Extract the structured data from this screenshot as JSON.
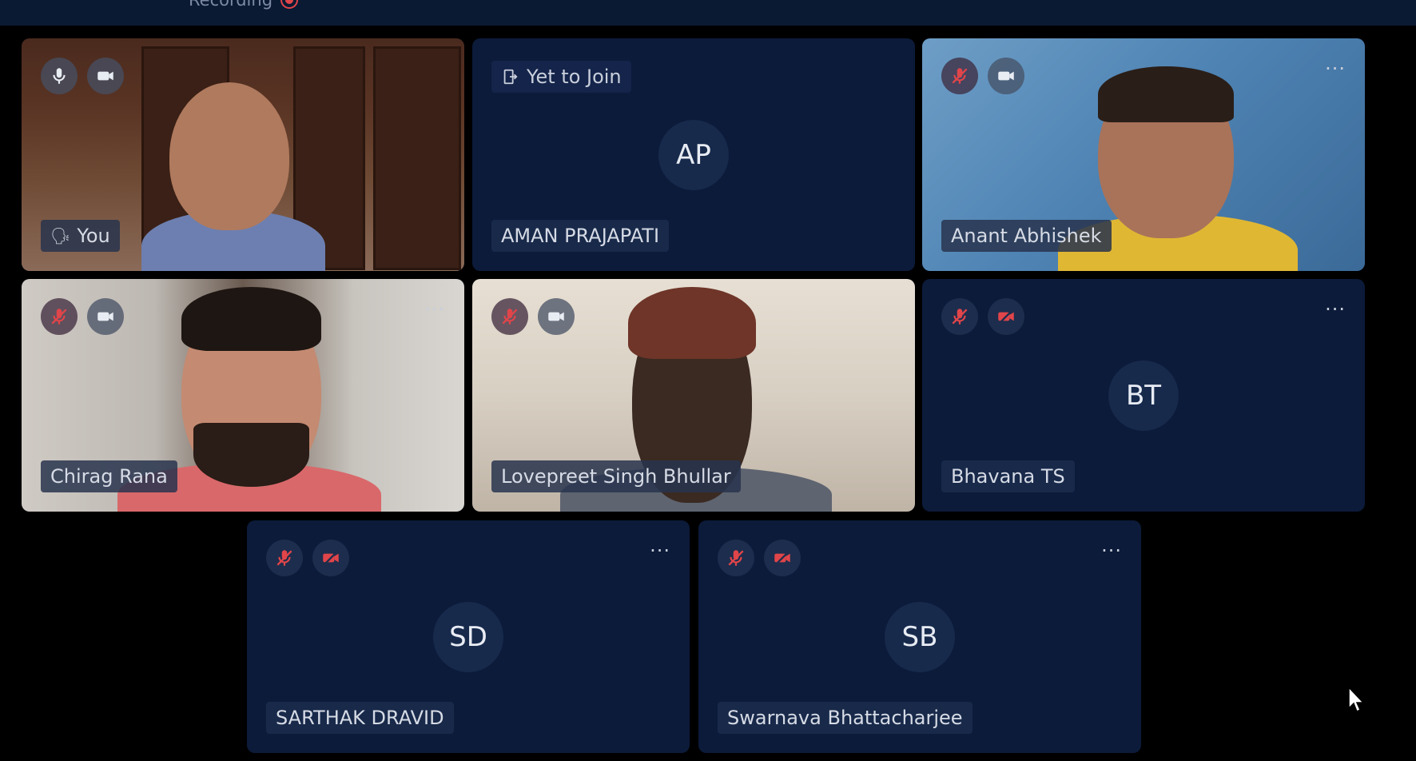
{
  "header": {
    "recording_label": "Recording"
  },
  "tiles": [
    {
      "name": "You",
      "mic": "on",
      "cam": "on",
      "speaking": true
    },
    {
      "name": "AMAN PRAJAPATI",
      "initials": "AP",
      "status": "Yet to Join"
    },
    {
      "name": "Anant Abhishek",
      "mic": "muted",
      "cam": "on"
    },
    {
      "name": "Chirag Rana",
      "mic": "muted",
      "cam": "on"
    },
    {
      "name": "Lovepreet Singh Bhullar",
      "mic": "muted",
      "cam": "on"
    },
    {
      "name": "Bhavana TS",
      "initials": "BT",
      "mic": "muted",
      "cam": "off"
    },
    {
      "name": "SARTHAK DRAVID",
      "initials": "SD",
      "mic": "muted",
      "cam": "off"
    },
    {
      "name": "Swarnava Bhattacharjee",
      "initials": "SB",
      "mic": "muted",
      "cam": "off"
    }
  ],
  "more_label": "···",
  "colors": {
    "tile_bg": "#0c1b3a",
    "muted_red": "#e0454a",
    "page_bg": "#000000"
  },
  "icons": [
    "mic-icon",
    "mic-off-icon",
    "camera-icon",
    "camera-off-icon",
    "more-options-icon",
    "speaking-icon",
    "leave-door-icon",
    "mouse-cursor-icon"
  ]
}
